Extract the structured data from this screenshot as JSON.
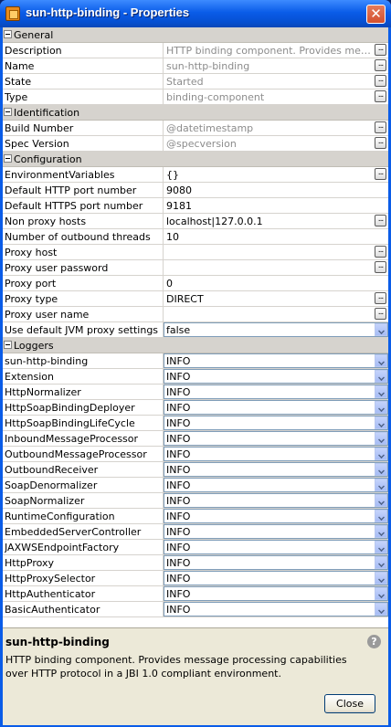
{
  "window": {
    "title": "sun-http-binding - Properties",
    "close_glyph": "✕"
  },
  "categories": {
    "general": "General",
    "identification": "Identification",
    "configuration": "Configuration",
    "loggers": "Loggers"
  },
  "general": [
    {
      "name": "Description",
      "value": "HTTP binding component. Provides message processing capabilities over HTTP protocol in a JBI 1.0 compliant environment."
    },
    {
      "name": "Name",
      "value": "sun-http-binding"
    },
    {
      "name": "State",
      "value": "Started"
    },
    {
      "name": "Type",
      "value": "binding-component"
    }
  ],
  "identification": [
    {
      "name": "Build Number",
      "value": "@datetimestamp"
    },
    {
      "name": "Spec Version",
      "value": "@specversion"
    }
  ],
  "configuration": [
    {
      "name": "EnvironmentVariables",
      "value": "{}"
    },
    {
      "name": "Default HTTP port number",
      "value": "9080"
    },
    {
      "name": "Default HTTPS port number",
      "value": "9181"
    },
    {
      "name": "Non proxy hosts",
      "value": "localhost|127.0.0.1"
    },
    {
      "name": "Number of outbound threads",
      "value": "10"
    },
    {
      "name": "Proxy host",
      "value": ""
    },
    {
      "name": "Proxy user password",
      "value": ""
    },
    {
      "name": "Proxy port",
      "value": "0"
    },
    {
      "name": "Proxy type",
      "value": "DIRECT"
    },
    {
      "name": "Proxy user name",
      "value": ""
    },
    {
      "name": "Use default JVM proxy settings",
      "value": "false"
    }
  ],
  "loggers": [
    {
      "name": "sun-http-binding",
      "value": "INFO"
    },
    {
      "name": "Extension",
      "value": "INFO"
    },
    {
      "name": "HttpNormalizer",
      "value": "INFO"
    },
    {
      "name": "HttpSoapBindingDeployer",
      "value": "INFO"
    },
    {
      "name": "HttpSoapBindingLifeCycle",
      "value": "INFO"
    },
    {
      "name": "InboundMessageProcessor",
      "value": "INFO"
    },
    {
      "name": "OutboundMessageProcessor",
      "value": "INFO"
    },
    {
      "name": "OutboundReceiver",
      "value": "INFO"
    },
    {
      "name": "SoapDenormalizer",
      "value": "INFO"
    },
    {
      "name": "SoapNormalizer",
      "value": "INFO"
    },
    {
      "name": "RuntimeConfiguration",
      "value": "INFO"
    },
    {
      "name": "EmbeddedServerController",
      "value": "INFO"
    },
    {
      "name": "JAXWSEndpointFactory",
      "value": "INFO"
    },
    {
      "name": "HttpProxy",
      "value": "INFO"
    },
    {
      "name": "HttpProxySelector",
      "value": "INFO"
    },
    {
      "name": "HttpAuthenticator",
      "value": "INFO"
    },
    {
      "name": "BasicAuthenticator",
      "value": "INFO"
    }
  ],
  "description_panel": {
    "name": "sun-http-binding",
    "text": "HTTP binding component. Provides message processing capabilities over HTTP protocol in a JBI 1.0 compliant environment.",
    "help_glyph": "?",
    "close_label": "Close"
  },
  "ellipsis_glyph": "..."
}
